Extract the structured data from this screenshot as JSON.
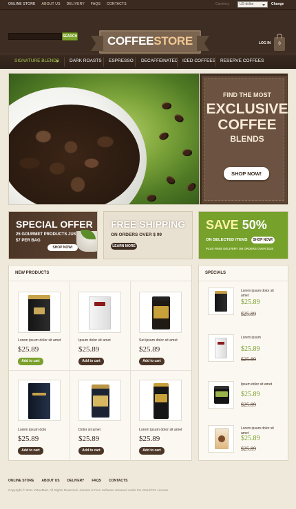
{
  "topbar": {
    "links": [
      "ONLINE STORE",
      "ABOUT US",
      "DELIVERY",
      "FAQS",
      "CONTACTS"
    ],
    "currency_label": "Currency",
    "currency_value": "US dollar",
    "change_label": "Change"
  },
  "header": {
    "search_button": "SEARCH",
    "logo_part1": "COFFEE",
    "logo_part2": "STORE",
    "login": "LOG IN",
    "cart_count": "0"
  },
  "nav": {
    "items": [
      "SIGNATURE BLENDS",
      "DARK ROASTS",
      "ESPRESSO",
      "DECAFFEINATED",
      "ICED COFFEES",
      "RESERVE COFFEES"
    ]
  },
  "banner": {
    "line1": "FIND THE MOST",
    "line2": "EXCLUSIVE",
    "line3": "COFFEE",
    "line4": "BLENDS",
    "button": "SHOP NOW!"
  },
  "promos": {
    "special": {
      "title": "SPECIAL OFFER",
      "line1": "25 GOURMET PRODUCTS JUST",
      "line2": "$7 PER BAG",
      "button": "SHOP NOW!"
    },
    "shipping": {
      "title": "FREE SHIPPING",
      "line1": "ON ORDERS OVER $ 99",
      "button": "LEARN MORE"
    },
    "save": {
      "title_a": "SAVE",
      "title_b": "50%",
      "line1": "ON SELECTED ITEMS",
      "button": "SHOP NOW!",
      "line2": "PLUS FREE DELIVERY ON ORDERS OVER $145"
    }
  },
  "new_products": {
    "title": "NEW PRODUCTS",
    "items": [
      {
        "name": "Lorem ipsum dolor sit amet",
        "price": "$25.89",
        "button": "Add to cart",
        "highlight": true
      },
      {
        "name": "Ipsum dolor sit amet",
        "price": "$25.89",
        "button": "Add to cart",
        "highlight": false
      },
      {
        "name": "Set ipsum dolor sit amet",
        "price": "$25.89",
        "button": "Add to cart",
        "highlight": false
      },
      {
        "name": "Lorem ipsum dolo",
        "price": "$25.89",
        "button": "Add to cart",
        "highlight": false
      },
      {
        "name": "Dolor sit amet",
        "price": "$25.89",
        "button": "Add to cart",
        "highlight": false
      },
      {
        "name": "Lorem ipsum dolor sit amet",
        "price": "$25.89",
        "button": "Add to cart",
        "highlight": false
      }
    ]
  },
  "specials": {
    "title": "SPECIALS",
    "items": [
      {
        "name": "Lorem ipsum dolor sit amet",
        "price": "$25.89",
        "old_price": "$25.89"
      },
      {
        "name": "Lorem ipsum",
        "price": "$25.89",
        "old_price": "$25.89"
      },
      {
        "name": "Ipsum dolor sit amet",
        "price": "$25.89",
        "old_price": "$25.89"
      },
      {
        "name": "Lorem ipsum dolor sit amet",
        "price": "$25.89",
        "old_price": "$25.89"
      }
    ]
  },
  "footer": {
    "links": [
      "ONLINE STORE",
      "ABOUT US",
      "DELIVERY",
      "FAQS",
      "CONTACTS"
    ],
    "copyright": "Copyright © 2011 VirtueMart. All Rights Reserved. Joomla! is Free Software released under the GNU/GPL License."
  },
  "colors": {
    "accent_green": "#7aa12c",
    "dark_brown": "#3e2d22",
    "cream": "#efe9db"
  }
}
